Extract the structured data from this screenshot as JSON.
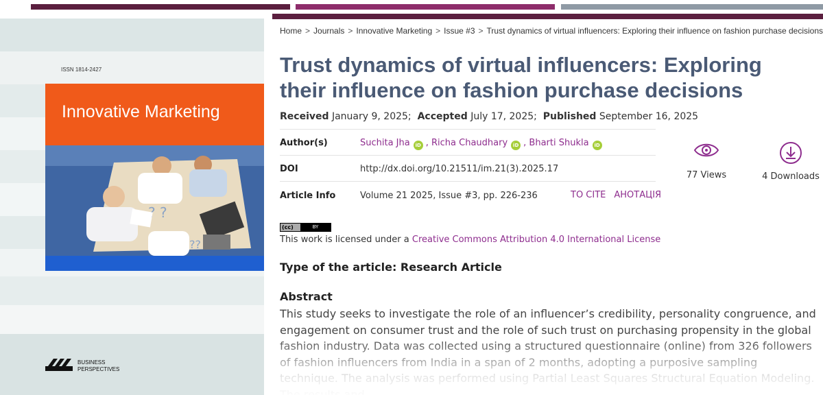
{
  "colors": {
    "top_bar_1": "#5b1f3f",
    "top_bar_2": "#8e2d6b",
    "top_bar_3": "#8f9aa5",
    "title": "#4a5a75",
    "link": "#8e2d8e",
    "cover_orange": "#f05a1a",
    "cover_blue": "#1f5fd0",
    "orcid_green": "#a6ce39"
  },
  "cover": {
    "issn": "ISSN 1814-2427",
    "journal_title": "Innovative Marketing",
    "publisher_line1": "BUSINESS",
    "publisher_line2": "PERSPECTIVES",
    "logo_icon": "business-perspectives-logo"
  },
  "breadcrumb": [
    "Home",
    "Journals",
    "Innovative Marketing",
    "Issue #3",
    "Trust dynamics of virtual influencers: Exploring their influence on fashion purchase decisions"
  ],
  "article": {
    "title": "Trust dynamics of virtual influencers: Exploring their influence on fashion purchase decisions",
    "received_label": "Received",
    "received": "January 9, 2025;",
    "accepted_label": "Accepted",
    "accepted": "July 17, 2025;",
    "published_label": "Published",
    "published": "September 16, 2025"
  },
  "meta": {
    "authors_label": "Author(s)",
    "authors": [
      "Suchita Jha",
      ", Richa Chaudhary",
      ", Bharti Shukla"
    ],
    "doi_label": "DOI",
    "doi": "http://dx.doi.org/10.21511/im.21(3).2025.17",
    "info_label": "Article Info",
    "info": "Volume 21 2025, Issue #3, pp. 226-236",
    "to_cite": "TO CITE",
    "annotation": "АНОТАЦІЯ",
    "orcid_text": "iD"
  },
  "stats": {
    "views": "77 Views",
    "downloads": "4 Downloads",
    "views_icon": "eye-icon",
    "downloads_icon": "download-icon"
  },
  "license": {
    "badge_cc": "(cc)",
    "badge_by": "BY",
    "prefix": "This work is licensed under a",
    "link": "Creative Commons Attribution 4.0 International License"
  },
  "type_heading": "Type of the article: Research Article",
  "abstract_heading": "Abstract",
  "abstract_text": "This study seeks to investigate the role of an influencer’s credibility, personality congruence, and engagement on consumer trust and the role of such trust on purchasing propensity in the global fashion industry. Data was collected using a structured questionnaire (online) from 326 followers of fashion influencers from India in a span of 2 months, adopting a purposive sampling technique. The analysis was performed using Partial Least Squares Structural Equation Modeling. The results and"
}
